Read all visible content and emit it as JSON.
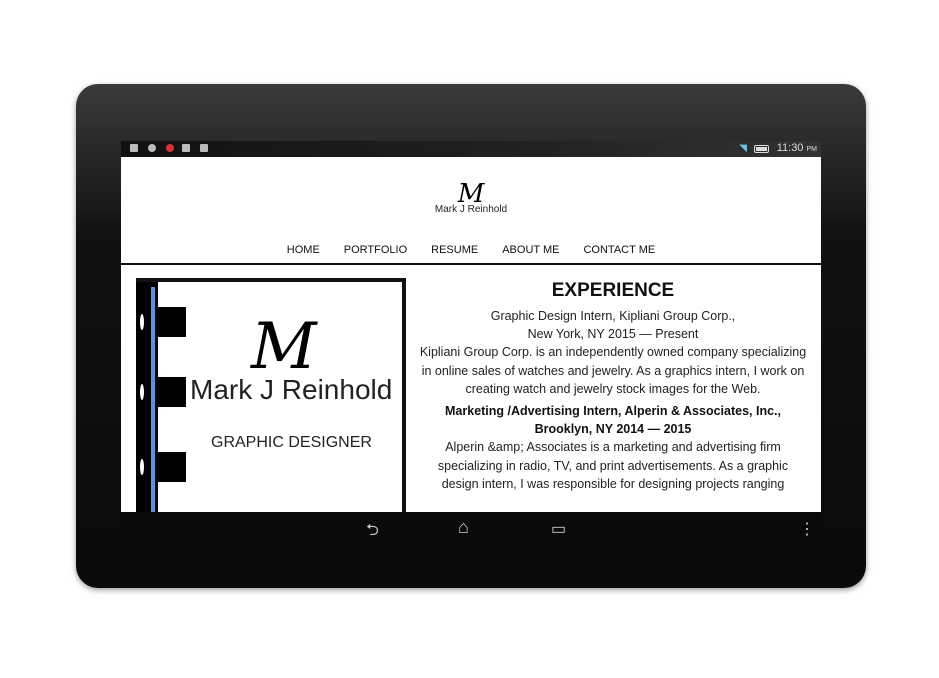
{
  "status_bar": {
    "time": "11:30",
    "ampm": "PM"
  },
  "header": {
    "logo_mark": "M",
    "brand": "Mark J Reinhold"
  },
  "nav": {
    "items": [
      "HOME",
      "PORTFOLIO",
      "RESUME",
      "ABOUT ME",
      "CONTACT ME"
    ]
  },
  "card": {
    "logo_mark": "M",
    "name": "Mark J Reinhold",
    "title": "GRAPHIC DESIGNER"
  },
  "experience": {
    "heading": "EXPERIENCE",
    "job1_title": "Graphic Design Intern, Kipliani Group Corp.,",
    "job1_location": "New York, NY 2015 — Present",
    "job1_desc": "Kipliani Group Corp. is an independently owned company specializing in online sales of watches and jewelry. As a graphics intern, I work on creating watch and jewelry stock images for the Web.",
    "job2_title": "Marketing /Advertising Intern, Alperin & Associates, Inc.,",
    "job2_location": "Brooklyn, NY 2014 — 2015",
    "job2_desc": "Alperin &amp; Associates is a marketing and advertising firm specializing in radio, TV, and print advertisements. As a graphic design intern, I was responsible for designing projects ranging"
  },
  "system_nav": {
    "back": "back-icon",
    "home": "home-icon",
    "recents": "recents-icon",
    "menu": "overflow-menu-icon"
  }
}
